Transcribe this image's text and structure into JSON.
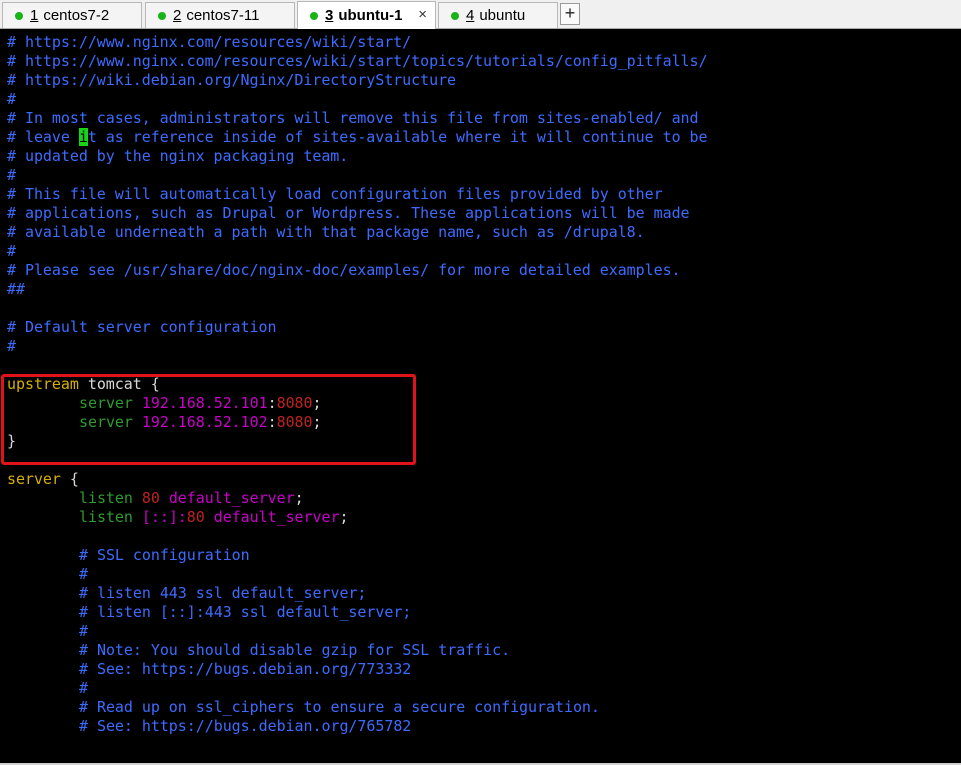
{
  "tabs": [
    {
      "num": "1",
      "label": "centos7-2",
      "active": false
    },
    {
      "num": "2",
      "label": "centos7-11",
      "active": false
    },
    {
      "num": "3",
      "label": "ubuntu-1",
      "active": true
    },
    {
      "num": "4",
      "label": "ubuntu",
      "active": false
    }
  ],
  "close_glyph": "×",
  "add_glyph": "+",
  "colors": {
    "accent_tab_dot": "#17b317",
    "highlight_box": "#e0121a",
    "comment": "#3d6bff"
  },
  "lines": {
    "l0": "# https://www.nginx.com/resources/wiki/start/",
    "l1": "# https://www.nginx.com/resources/wiki/start/topics/tutorials/config_pitfalls/",
    "l2": "# https://wiki.debian.org/Nginx/DirectoryStructure",
    "l3": "#",
    "l4": "# In most cases, administrators will remove this file from sites-enabled/ and",
    "l5a": "# leave ",
    "l5cur": "i",
    "l5b": "t as reference inside of sites-available where it will continue to be",
    "l6": "# updated by the nginx packaging team.",
    "l7": "#",
    "l8": "# This file will automatically load configuration files provided by other",
    "l9": "# applications, such as Drupal or Wordpress. These applications will be made",
    "l10": "# available underneath a path with that package name, such as /drupal8.",
    "l11": "#",
    "l12": "# Please see /usr/share/doc/nginx-doc/examples/ for more detailed examples.",
    "l13": "##",
    "l15": "# Default server configuration",
    "l16": "#",
    "up_kw": "upstream",
    "up_name": " tomcat {",
    "s1_kw": "server",
    "s1_ip": "192.168.52.101",
    "s1_colon": ":",
    "s1_port": "8080",
    "s1_semi": ";",
    "s2_kw": "server",
    "s2_ip": "192.168.52.102",
    "s2_colon": ":",
    "s2_port": "8080",
    "s2_semi": ";",
    "up_close": "}",
    "srv_kw": "server",
    "srv_open": " {",
    "lis1_kw": "listen",
    "lis1_port": "80",
    "lis1_val": "default_server",
    "lis1_semi": ";",
    "lis2_kw": "listen",
    "lis2_addr": "[::]:",
    "lis2_port": "80",
    "lis2_val": "default_server",
    "lis2_semi": ";",
    "c1": "# SSL configuration",
    "c2": "#",
    "c3": "# listen 443 ssl default_server;",
    "c4": "# listen [::]:443 ssl default_server;",
    "c5": "#",
    "c6": "# Note: You should disable gzip for SSL traffic.",
    "c7": "# See: https://bugs.debian.org/773332",
    "c8": "#",
    "c9": "# Read up on ssl_ciphers to ensure a secure configuration.",
    "c10": "# See: https://bugs.debian.org/765782"
  }
}
